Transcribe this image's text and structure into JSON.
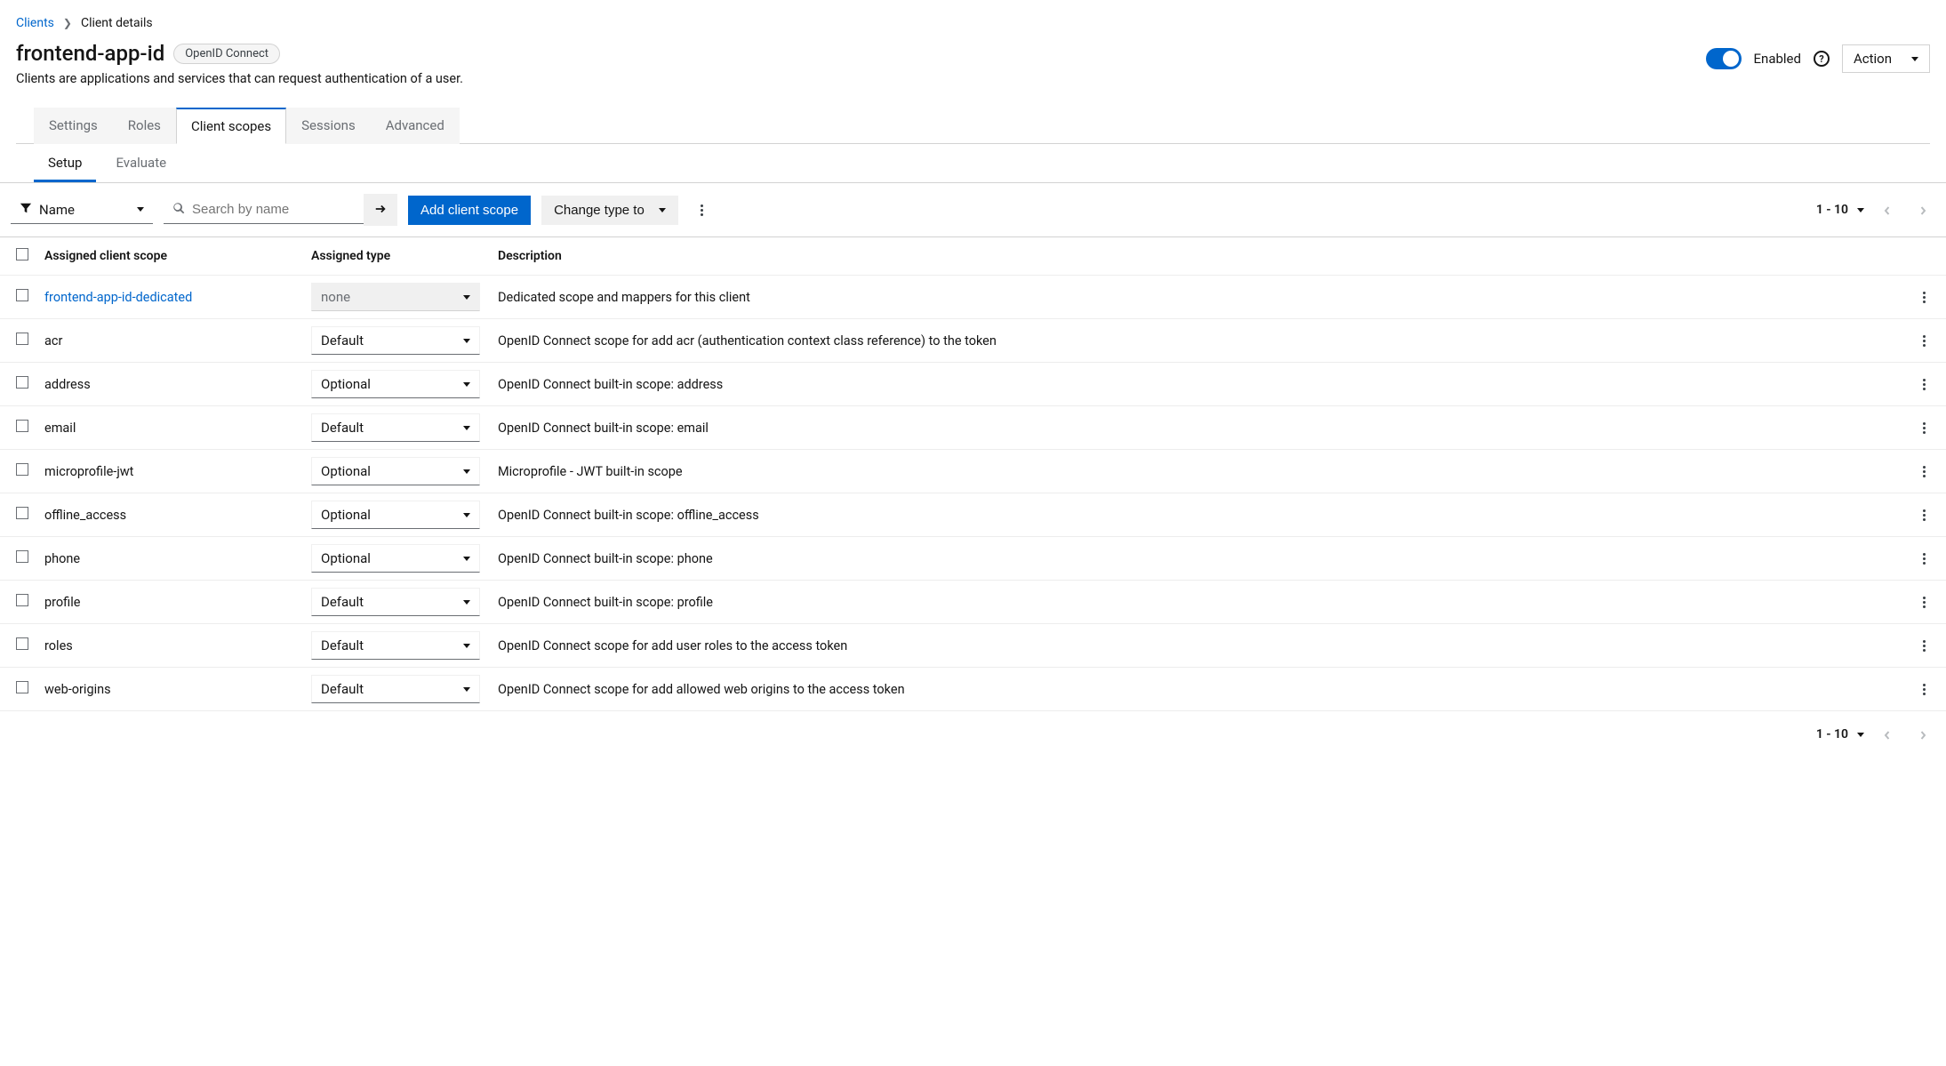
{
  "breadcrumb": {
    "parent": "Clients",
    "current": "Client details"
  },
  "header": {
    "title": "frontend-app-id",
    "badge": "OpenID Connect",
    "subtitle": "Clients are applications and services that can request authentication of a user.",
    "enabled_label": "Enabled",
    "action_label": "Action"
  },
  "tabs": {
    "items": [
      "Settings",
      "Roles",
      "Client scopes",
      "Sessions",
      "Advanced"
    ],
    "active": 2
  },
  "subtabs": {
    "items": [
      "Setup",
      "Evaluate"
    ],
    "active": 0
  },
  "toolbar": {
    "filter_label": "Name",
    "search_placeholder": "Search by name",
    "add_label": "Add client scope",
    "change_type_label": "Change type to"
  },
  "pagination": {
    "range_label": "1 - 10"
  },
  "table": {
    "headers": {
      "scope": "Assigned client scope",
      "type": "Assigned type",
      "description": "Description"
    },
    "type_options": [
      "Default",
      "Optional",
      "none"
    ],
    "rows": [
      {
        "scope": "frontend-app-id-dedicated",
        "is_link": true,
        "type": "none",
        "description": "Dedicated scope and mappers for this client"
      },
      {
        "scope": "acr",
        "is_link": false,
        "type": "Default",
        "description": "OpenID Connect scope for add acr (authentication context class reference) to the token"
      },
      {
        "scope": "address",
        "is_link": false,
        "type": "Optional",
        "description": "OpenID Connect built-in scope: address"
      },
      {
        "scope": "email",
        "is_link": false,
        "type": "Default",
        "description": "OpenID Connect built-in scope: email"
      },
      {
        "scope": "microprofile-jwt",
        "is_link": false,
        "type": "Optional",
        "description": "Microprofile - JWT built-in scope"
      },
      {
        "scope": "offline_access",
        "is_link": false,
        "type": "Optional",
        "description": "OpenID Connect built-in scope: offline_access"
      },
      {
        "scope": "phone",
        "is_link": false,
        "type": "Optional",
        "description": "OpenID Connect built-in scope: phone"
      },
      {
        "scope": "profile",
        "is_link": false,
        "type": "Default",
        "description": "OpenID Connect built-in scope: profile"
      },
      {
        "scope": "roles",
        "is_link": false,
        "type": "Default",
        "description": "OpenID Connect scope for add user roles to the access token"
      },
      {
        "scope": "web-origins",
        "is_link": false,
        "type": "Default",
        "description": "OpenID Connect scope for add allowed web origins to the access token"
      }
    ]
  }
}
